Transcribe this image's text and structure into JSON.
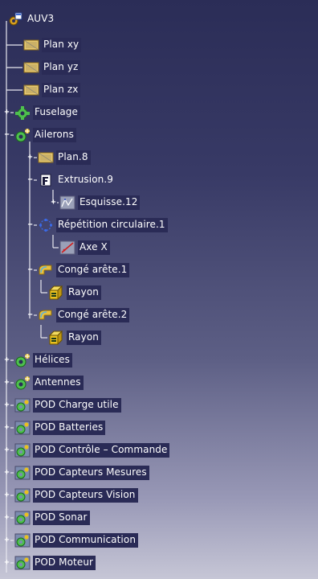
{
  "tree": {
    "root": {
      "label": "AUV3",
      "icon": "part-root-icon"
    },
    "planes": [
      {
        "label": "Plan xy",
        "icon": "plane-icon"
      },
      {
        "label": "Plan yz",
        "icon": "plane-icon"
      },
      {
        "label": "Plan zx",
        "icon": "plane-icon"
      }
    ],
    "fuselage": {
      "label": "Fuselage",
      "icon": "geometrical-set-icon",
      "expander": "+"
    },
    "ailerons": {
      "label": "Ailerons",
      "icon": "geometrical-set-new-icon",
      "expander": "−",
      "plan8": {
        "label": "Plan.8",
        "icon": "plane-icon",
        "expander": "+"
      },
      "extrusion9": {
        "label": "Extrusion.9",
        "icon": "extrusion-icon",
        "expander": "−",
        "esquisse12": {
          "label": "Esquisse.12",
          "icon": "sketch-icon",
          "expander": "+"
        }
      },
      "repetition": {
        "label": "Répétition circulaire.1",
        "icon": "circular-pattern-icon",
        "expander": "−",
        "axe": {
          "label": "Axe X",
          "icon": "axis-icon"
        }
      },
      "conge1": {
        "label": "Congé arête.1",
        "icon": "edge-fillet-icon",
        "expander": "−",
        "rayon": {
          "label": "Rayon",
          "icon": "parameter-icon"
        }
      },
      "conge2": {
        "label": "Congé arête.2",
        "icon": "edge-fillet-icon",
        "expander": "−",
        "rayon": {
          "label": "Rayon",
          "icon": "parameter-icon"
        }
      }
    },
    "helices": {
      "label": "Hélices",
      "icon": "geometrical-set-new-icon",
      "expander": "+"
    },
    "antennes": {
      "label": "Antennes",
      "icon": "geometrical-set-new-icon",
      "expander": "+"
    },
    "pods": [
      {
        "label": "POD Charge utile",
        "icon": "body-icon",
        "expander": "+"
      },
      {
        "label": "POD Batteries",
        "icon": "body-icon",
        "expander": "+"
      },
      {
        "label": "POD Contrôle – Commande",
        "icon": "body-icon",
        "expander": "+"
      },
      {
        "label": "POD Capteurs Mesures",
        "icon": "body-icon",
        "expander": "+"
      },
      {
        "label": "POD Capteurs Vision",
        "icon": "body-icon",
        "expander": "+"
      },
      {
        "label": "POD Sonar",
        "icon": "body-icon",
        "expander": "+"
      },
      {
        "label": "POD Communication",
        "icon": "body-icon",
        "expander": "+"
      },
      {
        "label": "POD Moteur",
        "icon": "body-icon",
        "expander": "+"
      }
    ]
  },
  "colors": {
    "label_highlight": "#2a2b56",
    "tree_line": "#e8e8f0",
    "background_top": "#2b2d57",
    "background_bottom": "#c6c6d6"
  }
}
